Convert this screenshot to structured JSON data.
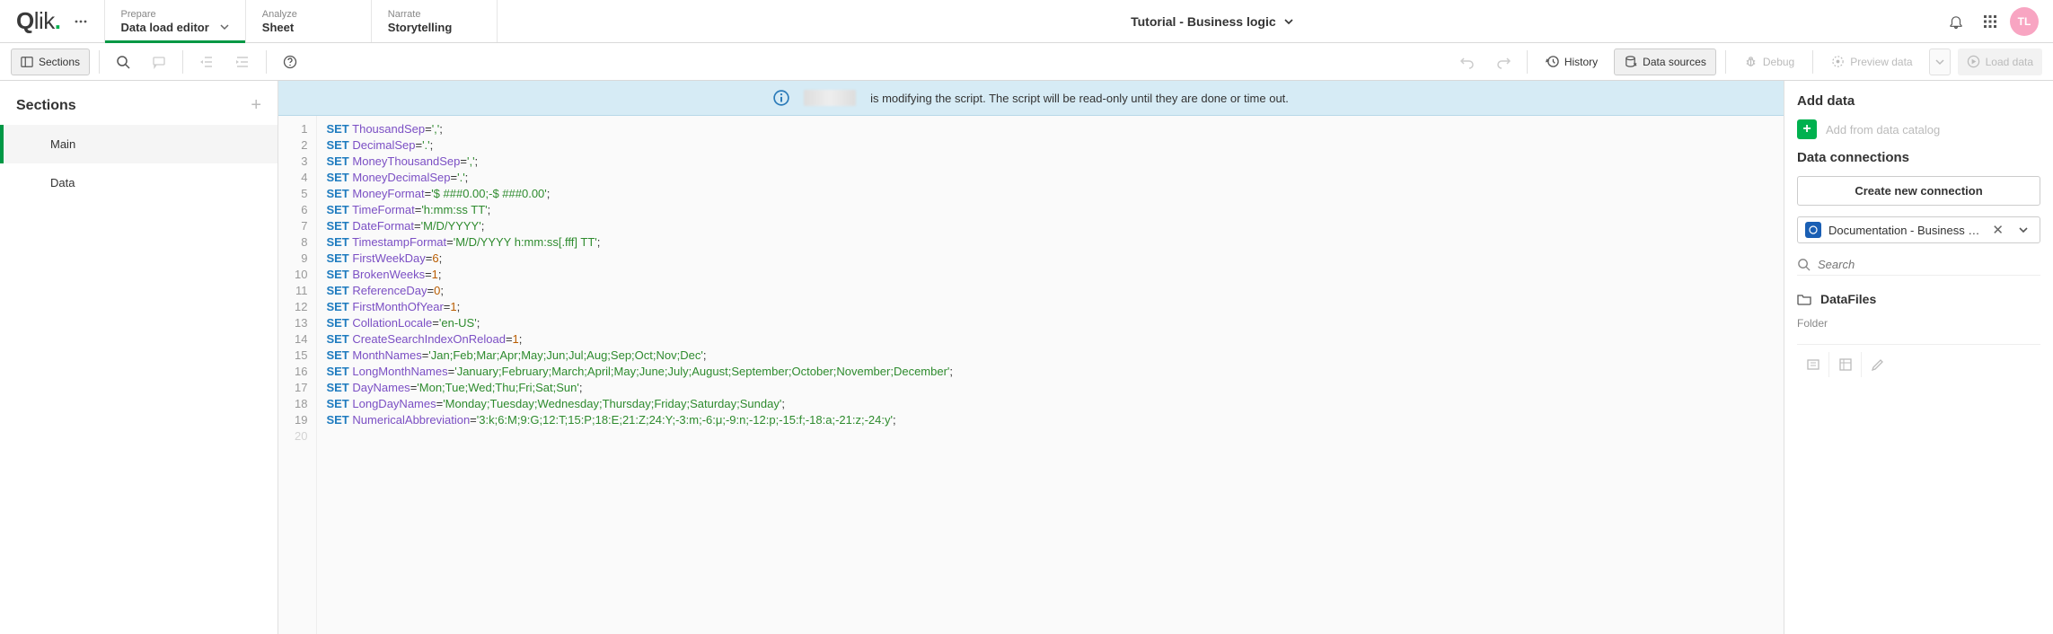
{
  "logo": "Qlik",
  "nav": {
    "prepare": {
      "sub": "Prepare",
      "main": "Data load editor"
    },
    "analyze": {
      "sub": "Analyze",
      "main": "Sheet"
    },
    "narrate": {
      "sub": "Narrate",
      "main": "Storytelling"
    }
  },
  "app_title": "Tutorial - Business logic",
  "avatar": "TL",
  "toolbar": {
    "sections": "Sections",
    "history": "History",
    "data_sources": "Data sources",
    "debug": "Debug",
    "preview_data": "Preview data",
    "load_data": "Load data"
  },
  "sections_panel": {
    "title": "Sections",
    "items": [
      "Main",
      "Data"
    ],
    "active_index": 0
  },
  "banner": {
    "text": "is modifying the script. The script will be read-only until they are done or time out."
  },
  "code": [
    [
      [
        "kw",
        "SET"
      ],
      [
        "sp",
        " "
      ],
      [
        "var",
        "ThousandSep"
      ],
      [
        "op",
        "="
      ],
      [
        "str",
        "','"
      ],
      [
        "op",
        ";"
      ]
    ],
    [
      [
        "kw",
        "SET"
      ],
      [
        "sp",
        " "
      ],
      [
        "var",
        "DecimalSep"
      ],
      [
        "op",
        "="
      ],
      [
        "str",
        "'.'"
      ],
      [
        "op",
        ";"
      ]
    ],
    [
      [
        "kw",
        "SET"
      ],
      [
        "sp",
        " "
      ],
      [
        "var",
        "MoneyThousandSep"
      ],
      [
        "op",
        "="
      ],
      [
        "str",
        "','"
      ],
      [
        "op",
        ";"
      ]
    ],
    [
      [
        "kw",
        "SET"
      ],
      [
        "sp",
        " "
      ],
      [
        "var",
        "MoneyDecimalSep"
      ],
      [
        "op",
        "="
      ],
      [
        "str",
        "'.'"
      ],
      [
        "op",
        ";"
      ]
    ],
    [
      [
        "kw",
        "SET"
      ],
      [
        "sp",
        " "
      ],
      [
        "var",
        "MoneyFormat"
      ],
      [
        "op",
        "="
      ],
      [
        "str",
        "'$ ###0.00;-$ ###0.00'"
      ],
      [
        "op",
        ";"
      ]
    ],
    [
      [
        "kw",
        "SET"
      ],
      [
        "sp",
        " "
      ],
      [
        "var",
        "TimeFormat"
      ],
      [
        "op",
        "="
      ],
      [
        "str",
        "'h:mm:ss TT'"
      ],
      [
        "op",
        ";"
      ]
    ],
    [
      [
        "kw",
        "SET"
      ],
      [
        "sp",
        " "
      ],
      [
        "var",
        "DateFormat"
      ],
      [
        "op",
        "="
      ],
      [
        "str",
        "'M/D/YYYY'"
      ],
      [
        "op",
        ";"
      ]
    ],
    [
      [
        "kw",
        "SET"
      ],
      [
        "sp",
        " "
      ],
      [
        "var",
        "TimestampFormat"
      ],
      [
        "op",
        "="
      ],
      [
        "str",
        "'M/D/YYYY h:mm:ss[.fff] TT'"
      ],
      [
        "op",
        ";"
      ]
    ],
    [
      [
        "kw",
        "SET"
      ],
      [
        "sp",
        " "
      ],
      [
        "var",
        "FirstWeekDay"
      ],
      [
        "op",
        "="
      ],
      [
        "num",
        "6"
      ],
      [
        "op",
        ";"
      ]
    ],
    [
      [
        "kw",
        "SET"
      ],
      [
        "sp",
        " "
      ],
      [
        "var",
        "BrokenWeeks"
      ],
      [
        "op",
        "="
      ],
      [
        "num",
        "1"
      ],
      [
        "op",
        ";"
      ]
    ],
    [
      [
        "kw",
        "SET"
      ],
      [
        "sp",
        " "
      ],
      [
        "var",
        "ReferenceDay"
      ],
      [
        "op",
        "="
      ],
      [
        "num",
        "0"
      ],
      [
        "op",
        ";"
      ]
    ],
    [
      [
        "kw",
        "SET"
      ],
      [
        "sp",
        " "
      ],
      [
        "var",
        "FirstMonthOfYear"
      ],
      [
        "op",
        "="
      ],
      [
        "num",
        "1"
      ],
      [
        "op",
        ";"
      ]
    ],
    [
      [
        "kw",
        "SET"
      ],
      [
        "sp",
        " "
      ],
      [
        "var",
        "CollationLocale"
      ],
      [
        "op",
        "="
      ],
      [
        "str",
        "'en-US'"
      ],
      [
        "op",
        ";"
      ]
    ],
    [
      [
        "kw",
        "SET"
      ],
      [
        "sp",
        " "
      ],
      [
        "var",
        "CreateSearchIndexOnReload"
      ],
      [
        "op",
        "="
      ],
      [
        "num",
        "1"
      ],
      [
        "op",
        ";"
      ]
    ],
    [
      [
        "kw",
        "SET"
      ],
      [
        "sp",
        " "
      ],
      [
        "var",
        "MonthNames"
      ],
      [
        "op",
        "="
      ],
      [
        "str",
        "'Jan;Feb;Mar;Apr;May;Jun;Jul;Aug;Sep;Oct;Nov;Dec'"
      ],
      [
        "op",
        ";"
      ]
    ],
    [
      [
        "kw",
        "SET"
      ],
      [
        "sp",
        " "
      ],
      [
        "var",
        "LongMonthNames"
      ],
      [
        "op",
        "="
      ],
      [
        "str",
        "'January;February;March;April;May;June;July;August;September;October;November;December'"
      ],
      [
        "op",
        ";"
      ]
    ],
    [
      [
        "kw",
        "SET"
      ],
      [
        "sp",
        " "
      ],
      [
        "var",
        "DayNames"
      ],
      [
        "op",
        "="
      ],
      [
        "str",
        "'Mon;Tue;Wed;Thu;Fri;Sat;Sun'"
      ],
      [
        "op",
        ";"
      ]
    ],
    [
      [
        "kw",
        "SET"
      ],
      [
        "sp",
        " "
      ],
      [
        "var",
        "LongDayNames"
      ],
      [
        "op",
        "="
      ],
      [
        "str",
        "'Monday;Tuesday;Wednesday;Thursday;Friday;Saturday;Sunday'"
      ],
      [
        "op",
        ";"
      ]
    ],
    [
      [
        "kw",
        "SET"
      ],
      [
        "sp",
        " "
      ],
      [
        "var",
        "NumericalAbbreviation"
      ],
      [
        "op",
        "="
      ],
      [
        "str",
        "'3:k;6:M;9:G;12:T;15:P;18:E;21:Z;24:Y;-3:m;-6:μ;-9:n;-12:p;-15:f;-18:a;-21:z;-24:y'"
      ],
      [
        "op",
        ";"
      ]
    ]
  ],
  "right_panel": {
    "add_data": "Add data",
    "add_catalog": "Add from data catalog",
    "data_connections": "Data connections",
    "create_conn": "Create new connection",
    "connection_name": "Documentation - Business Logic ...",
    "search_placeholder": "Search",
    "folder_name": "DataFiles",
    "folder_label": "Folder"
  }
}
